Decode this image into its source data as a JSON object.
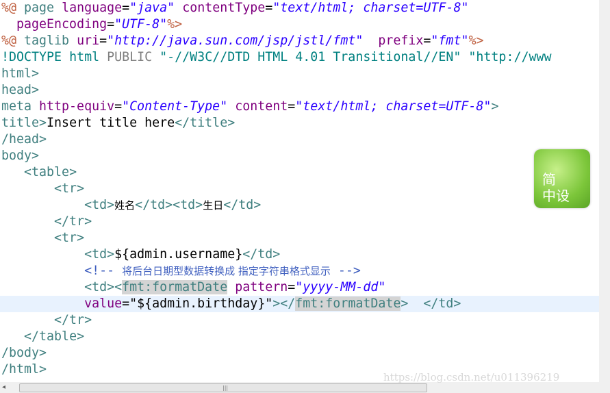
{
  "editor": {
    "lines": {
      "l1": {
        "a": "%@",
        "b": " page ",
        "c": "language",
        "d": "=",
        "e": "\"java\"",
        "f": " ",
        "g": "contentType",
        "h": "=",
        "i": "\"text/html; charset=UTF-8\""
      },
      "l2": {
        "a": "  ",
        "b": "pageEncoding",
        "c": "=",
        "d": "\"UTF-8\"",
        "e": "%>"
      },
      "l3": {
        "a": "%@",
        "b": " taglib ",
        "c": "uri",
        "d": "=",
        "e": "\"http://java.sun.com/jsp/jstl/fmt\"",
        "f": "  ",
        "g": "prefix",
        "h": "=",
        "i": "\"fmt\"",
        "j": "%>"
      },
      "l4": {
        "a": "!DOCTYPE ",
        "b": "html",
        "c": " PUBLIC ",
        "d": "\"-//W3C//DTD HTML 4.01 Transitional//EN\" \"http://www"
      },
      "l5": {
        "a": "html>"
      },
      "l6": {
        "a": "head>"
      },
      "l7": {
        "a": "meta ",
        "b": "http-equiv",
        "c": "=",
        "d": "\"Content-Type\"",
        "e": " ",
        "f": "content",
        "g": "=",
        "h": "\"text/html; charset=UTF-8\"",
        "i": ">"
      },
      "l8": {
        "a": "title>",
        "b": "Insert title here",
        "c": "</title>"
      },
      "l9": {
        "a": "/head>"
      },
      "l10": {
        "a": "body>"
      },
      "l11": {
        "a": "   ",
        "b": "<table>"
      },
      "l12": {
        "a": "       ",
        "b": "<tr>"
      },
      "l13": {
        "a": "           ",
        "b": "<td>",
        "c": "姓名",
        "d": "</td><td>",
        "e": "生日",
        "f": "</td>"
      },
      "l14": {
        "a": "       ",
        "b": "</tr>"
      },
      "l15": {
        "a": "       ",
        "b": "<tr>"
      },
      "l16": {
        "a": "           ",
        "b": "<td>",
        "c": "${admin.username}",
        "d": "</td>"
      },
      "l17": {
        "a": "           ",
        "b": "<!-- ",
        "c": "将后台日期型数据转换成 指定字符串格式显示",
        "d": " -->"
      },
      "l18": {
        "a": "           ",
        "b": "<td><",
        "c": "fmt:formatDate",
        "d": " ",
        "e": "pattern",
        "f": "=",
        "g": "\"yyyy-MM-dd\""
      },
      "l19": {
        "a": "           ",
        "b": "value",
        "c": "=",
        "d": "\"${admin.birthday}\"",
        "e": "></",
        "f": "fmt:formatDate",
        "g": ">  ",
        "h": "</td>"
      },
      "l20": {
        "a": "       ",
        "b": "</tr>"
      },
      "l21": {
        "a": "   ",
        "b": "</table>"
      },
      "l22": {
        "a": "/body>"
      },
      "l23": {
        "a": "/html>"
      }
    }
  },
  "overlay": {
    "line1": "简",
    "line2": "中设"
  },
  "watermark": "https://blog.csdn.net/u011396219",
  "scrollbar": {
    "grip": "|||"
  }
}
